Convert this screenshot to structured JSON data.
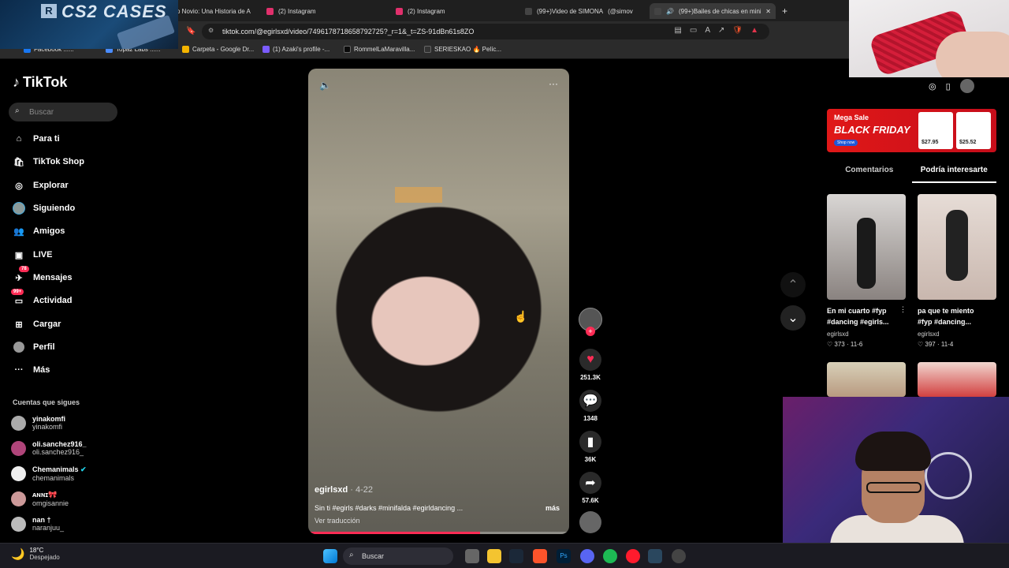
{
  "browser": {
    "tabs": [
      {
        "label": "o Novio: Una Historia de A",
        "favicon_color": "#2b2b2b"
      },
      {
        "label": "(2) Instagram",
        "favicon_color": "#e1306c"
      },
      {
        "label": "(2) Instagram",
        "favicon_color": "#e1306c"
      },
      {
        "label": "(99+)Video de SIMONA",
        "label2": "(@simov",
        "favicon_color": "#111111"
      },
      {
        "label": "(99+)Bailes de chicas en mini",
        "favicon_color": "#111111",
        "active": true
      }
    ],
    "new_tab": "+",
    "url": "tiktok.com/@egirlsxd/video/7496178718658792725?_r=1&_t=ZS-91dBn61s8ZO",
    "bookmarks": [
      {
        "label": "Facebook ......",
        "color": "#1877f2"
      },
      {
        "label": "Topaz Labs ......",
        "color": "#4a8cff"
      },
      {
        "label": "Carpeta - Google Dr...",
        "color": "#f4b400"
      },
      {
        "label": "(1) Azaki's profile -...",
        "color": "#7b5cff"
      },
      {
        "label": "RommelLaMaravilla...",
        "color": "#111111"
      },
      {
        "label": "SERIESKAO 🔥 Pelíc...",
        "color": "#222222"
      }
    ]
  },
  "overlay": {
    "brand": "CS2 CASES",
    "badge": "R"
  },
  "sidebar": {
    "logo": "TikTok",
    "search_placeholder": "Buscar",
    "nav": [
      {
        "label": "Para ti",
        "icon": "home-icon",
        "active": true
      },
      {
        "label": "TikTok Shop",
        "icon": "shop-icon"
      },
      {
        "label": "Explorar",
        "icon": "compass-icon"
      },
      {
        "label": "Siguiendo",
        "icon": "avatar-icon"
      },
      {
        "label": "Amigos",
        "icon": "friends-icon"
      },
      {
        "label": "LIVE",
        "icon": "live-icon"
      },
      {
        "label": "Mensajes",
        "icon": "message-icon",
        "badge": "78"
      },
      {
        "label": "Actividad",
        "icon": "activity-icon",
        "badge": "99+"
      },
      {
        "label": "Cargar",
        "icon": "upload-icon"
      },
      {
        "label": "Perfil",
        "icon": "profile-icon"
      },
      {
        "label": "Más",
        "icon": "more-icon"
      }
    ],
    "following_title": "Cuentas que sigues",
    "following": [
      {
        "name": "yinakomfi",
        "handle": "yinakomfi"
      },
      {
        "name": "oli.sanchez916_",
        "handle": "oli.sanchez916_"
      },
      {
        "name": "Chemanimals",
        "handle": "chemanimals",
        "verified": true
      },
      {
        "name": "ᴀɴɴɪ🎀",
        "handle": "omgisannie"
      },
      {
        "name": "nan †",
        "handle": "naranjuu_"
      }
    ]
  },
  "video": {
    "author": "egirlsxd",
    "date": "· 4-22",
    "description": "Sin ti #egirls #darks #minifalda #egirldancing ...",
    "more": "más",
    "translate": "Ver traducción",
    "progress": 0.66
  },
  "actions": {
    "likes": "251.3K",
    "comments": "1348",
    "saves": "36K",
    "shares": "57.6K"
  },
  "right": {
    "ad": {
      "line1": "Mega Sale",
      "line2": "BLACK FRIDAY",
      "cta": "Shop now",
      "price1": "$27.95",
      "price2": "$25.52"
    },
    "tabs": [
      "Comentarios",
      "Podría interesarte"
    ],
    "videos": [
      {
        "caption1": "En mi cuarto #fyp",
        "caption2": "#dancing #egirls...",
        "user": "egirlsxd",
        "stats": "♡ 373 · 11-6"
      },
      {
        "caption1": "pa que te miento",
        "caption2": "#fyp #dancing...",
        "user": "egirlsxd",
        "stats": "♡ 397 · 11-4"
      }
    ]
  },
  "taskbar": {
    "temp": "18°C",
    "weather": "Despejado",
    "search": "Buscar"
  }
}
